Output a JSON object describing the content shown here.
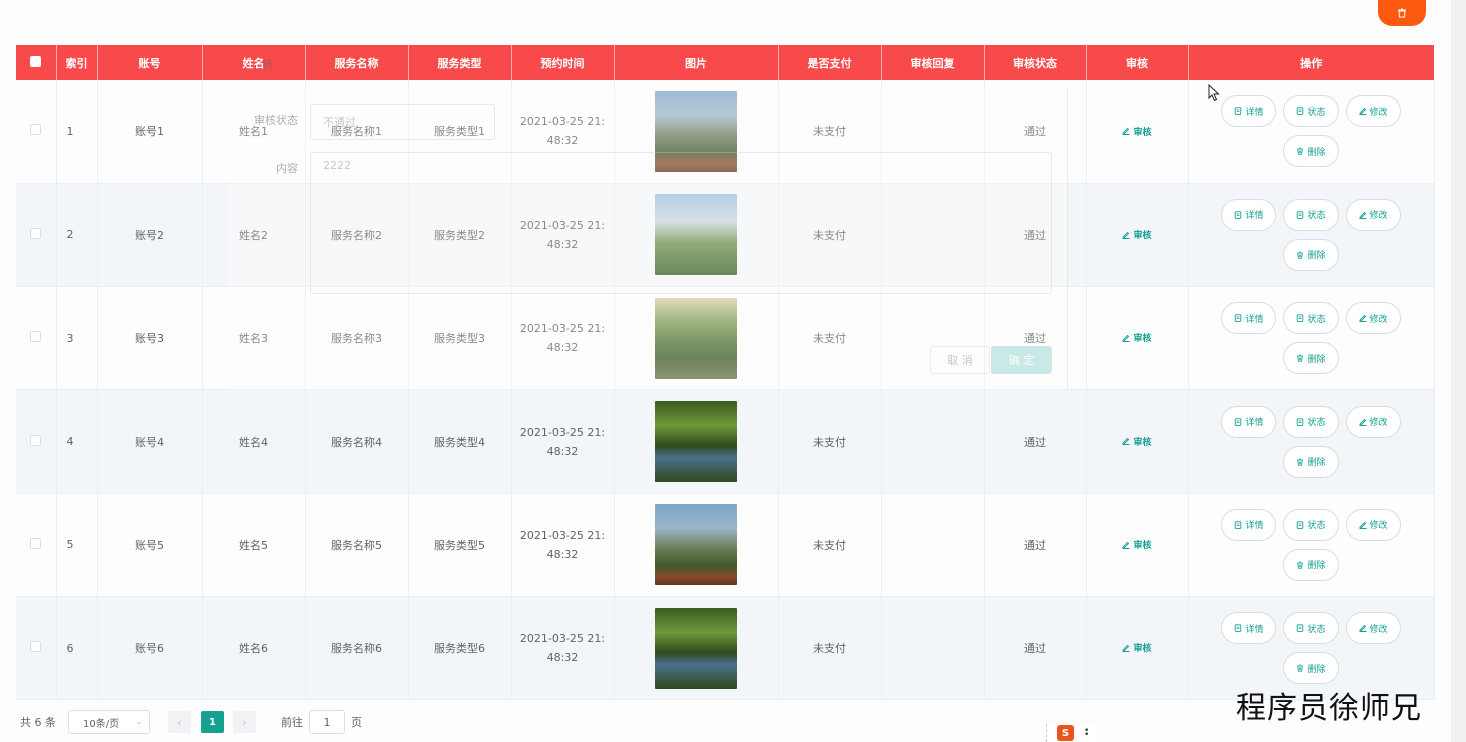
{
  "header": {
    "columns": [
      "",
      "索引",
      "账号",
      "姓名",
      "服务名称",
      "服务类型",
      "预约时间",
      "图片",
      "是否支付",
      "审核回复",
      "审核状态",
      "审核",
      "操作"
    ]
  },
  "rows": [
    {
      "index": "1",
      "account": "账号1",
      "name": "姓名1",
      "service_name": "服务名称1",
      "service_type": "服务类型1",
      "time": "2021-03-25 21:48:32",
      "paid": "未支付",
      "reply": "",
      "status": "通过"
    },
    {
      "index": "2",
      "account": "账号2",
      "name": "姓名2",
      "service_name": "服务名称2",
      "service_type": "服务类型2",
      "time": "2021-03-25 21:48:32",
      "paid": "未支付",
      "reply": "",
      "status": "通过"
    },
    {
      "index": "3",
      "account": "账号3",
      "name": "姓名3",
      "service_name": "服务名称3",
      "service_type": "服务类型3",
      "time": "2021-03-25 21:48:32",
      "paid": "未支付",
      "reply": "",
      "status": "通过"
    },
    {
      "index": "4",
      "account": "账号4",
      "name": "姓名4",
      "service_name": "服务名称4",
      "service_type": "服务类型4",
      "time": "2021-03-25 21:48:32",
      "paid": "未支付",
      "reply": "",
      "status": "通过"
    },
    {
      "index": "5",
      "account": "账号5",
      "name": "姓名5",
      "service_name": "服务名称5",
      "service_type": "服务类型5",
      "time": "2021-03-25 21:48:32",
      "paid": "未支付",
      "reply": "",
      "status": "通过"
    },
    {
      "index": "6",
      "account": "账号6",
      "name": "姓名6",
      "service_name": "服务名称6",
      "service_type": "服务类型6",
      "time": "2021-03-25 21:48:32",
      "paid": "未支付",
      "reply": "",
      "status": "通过"
    }
  ],
  "actions": {
    "audit": "审核",
    "detail": "详情",
    "state": "状态",
    "edit": "修改",
    "delete": "删除"
  },
  "ghost_dialog": {
    "title_fragment": "核",
    "status_label": "审核状态",
    "status_value": "不通过",
    "content_label": "内容",
    "content_value": "2222",
    "cancel": "取 消",
    "confirm": "确 定"
  },
  "pagination": {
    "total": "共 6 条",
    "page_size": "10条/页",
    "current_page": "1",
    "goto_label": "前往",
    "goto_value": "1",
    "page_unit": "页"
  },
  "watermark": "程序员徐师兄",
  "colors": {
    "header_red": "#f84a4a",
    "accent_teal": "#15a091",
    "top_delete_orange": "#fc5a10"
  },
  "icons": {
    "top_delete": "trash-icon",
    "audit": "pencil-icon",
    "detail": "document-icon",
    "state": "document-icon",
    "edit": "pencil-icon",
    "delete": "trash-icon"
  }
}
